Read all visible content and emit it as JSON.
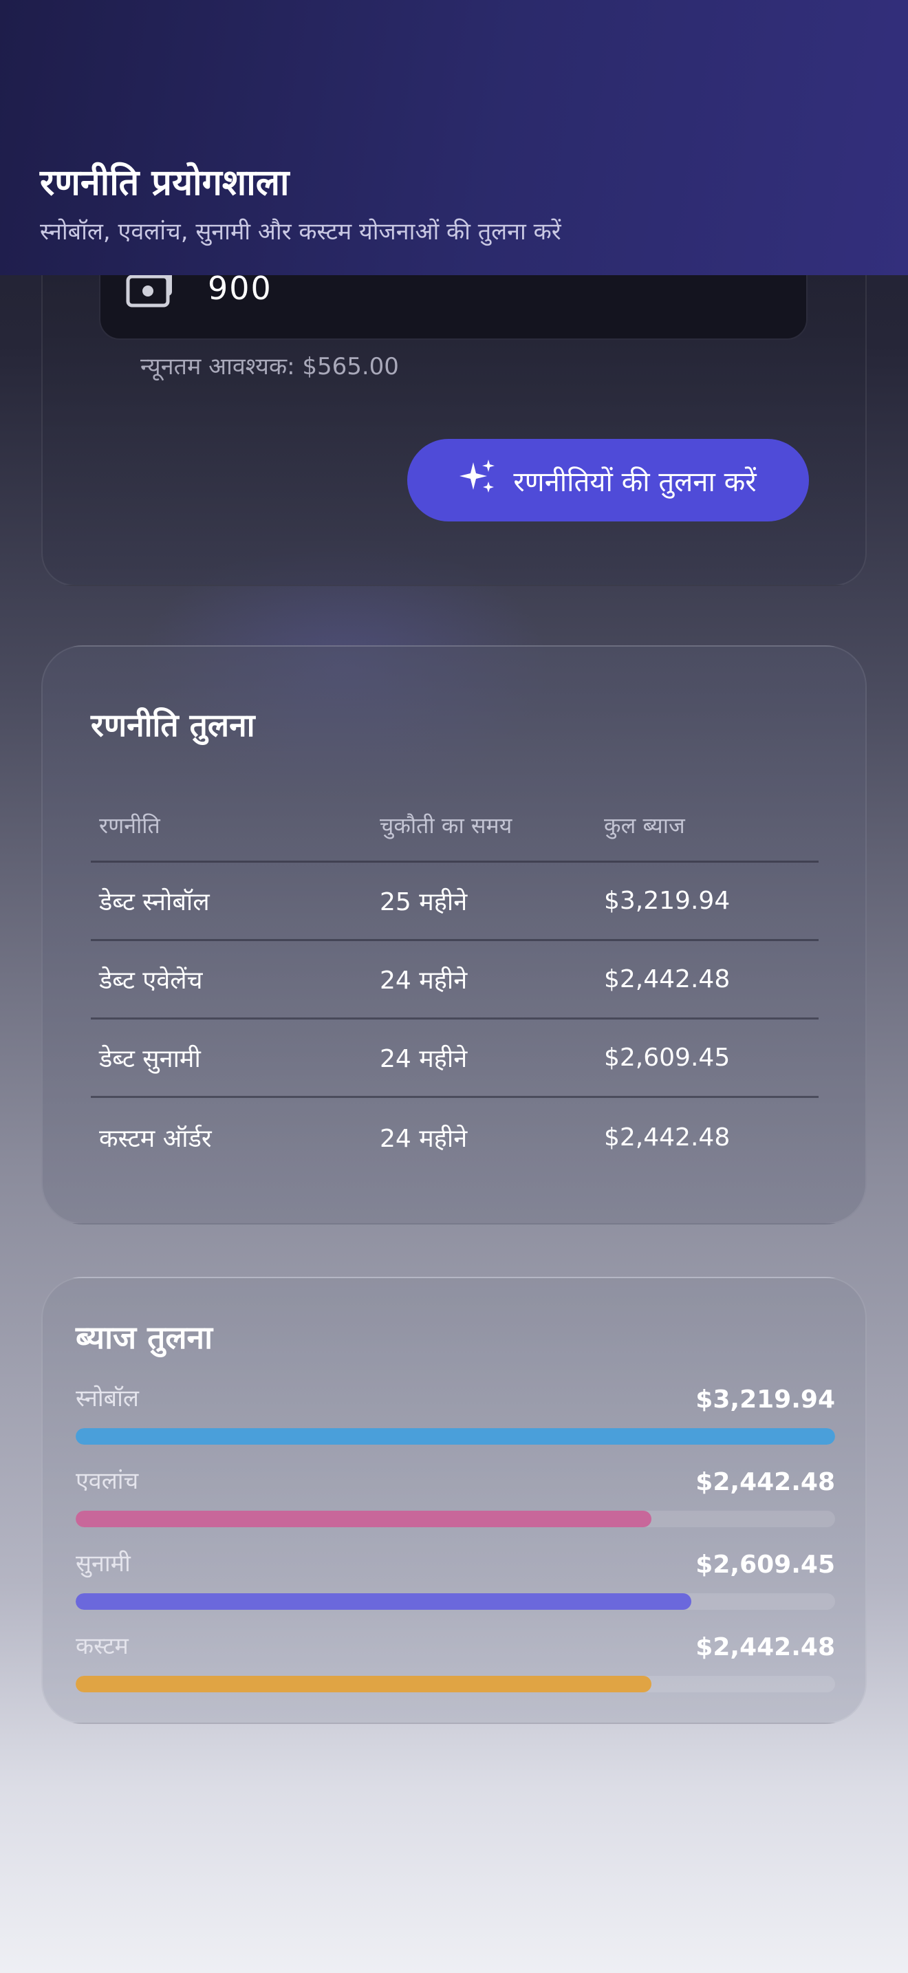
{
  "header": {
    "title": "रणनीति प्रयोगशाला",
    "subtitle": "स्नोबॉल, एवलांच, सुनामी और कस्टम योजनाओं की तुलना करें"
  },
  "input_section": {
    "amount_icon": "money-icon",
    "amount_value": "900",
    "min_required": "न्यूनतम आवश्यक: $565.00",
    "compare_button_icon": "sparkles-icon",
    "compare_button_label": "रणनीतियों की तुलना करें"
  },
  "comparison_table": {
    "title": "रणनीति तुलना",
    "columns": [
      "रणनीति",
      "चुकौती का समय",
      "कुल ब्याज"
    ],
    "rows": [
      {
        "strategy": "डेब्ट स्नोबॉल",
        "payoff_time": "25 महीने",
        "total_interest": "$3,219.94"
      },
      {
        "strategy": "डेब्ट एवेलेंच",
        "payoff_time": "24 महीने",
        "total_interest": "$2,442.48"
      },
      {
        "strategy": "डेब्ट सुनामी",
        "payoff_time": "24 महीने",
        "total_interest": "$2,609.45"
      },
      {
        "strategy": "कस्टम ऑर्डर",
        "payoff_time": "24 महीने",
        "total_interest": "$2,442.48"
      }
    ]
  },
  "interest_comparison": {
    "title": "ब्याज तुलना",
    "items": [
      {
        "label": "स्नोबॉल",
        "value": "$3,219.94",
        "amount": 3219.94,
        "fraction": 1.0,
        "color": "#4a9fda"
      },
      {
        "label": "एवलांच",
        "value": "$2,442.48",
        "amount": 2442.48,
        "fraction": 0.7585,
        "color": "#c8679a"
      },
      {
        "label": "सुनामी",
        "value": "$2,609.45",
        "amount": 2609.45,
        "fraction": 0.8104,
        "color": "#6b68dc"
      },
      {
        "label": "कस्टम",
        "value": "$2,442.48",
        "amount": 2442.48,
        "fraction": 0.7585,
        "color": "#e0a444"
      }
    ]
  },
  "colors": {
    "accent": "#4f4bd8",
    "header_bg": "#2b2a6b"
  }
}
